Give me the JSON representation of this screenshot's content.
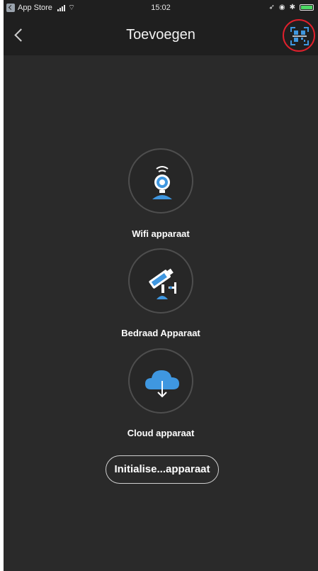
{
  "status_bar": {
    "carrier": "App Store",
    "time": "15:02"
  },
  "nav": {
    "title": "Toevoegen"
  },
  "options": [
    {
      "label": "Wifi apparaat",
      "icon": "wifi-camera-icon"
    },
    {
      "label": "Bedraad Apparaat",
      "icon": "wired-camera-icon"
    },
    {
      "label": "Cloud apparaat",
      "icon": "cloud-download-icon"
    }
  ],
  "init_button": {
    "label": "Initialise...apparaat"
  },
  "colors": {
    "background": "#2a2a2a",
    "bar": "#1f1f1f",
    "accent_blue": "#3f97e0",
    "scan_highlight": "#e0202c"
  }
}
